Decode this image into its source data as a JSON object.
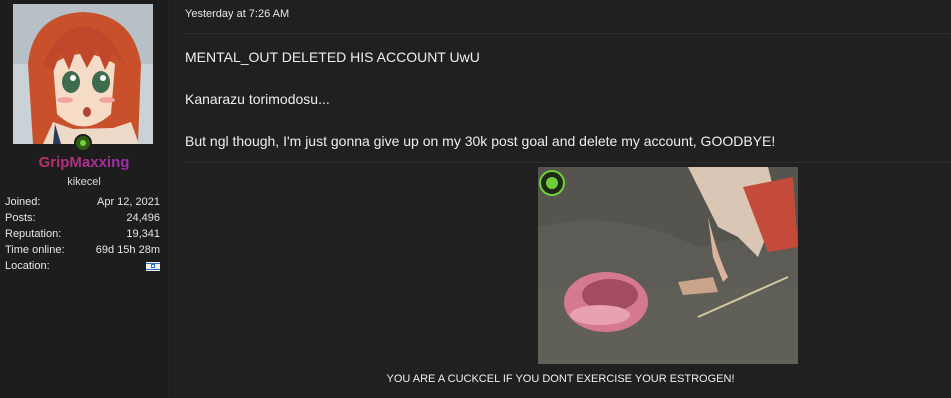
{
  "user": {
    "avatar_icon": "anime-girl-avatar",
    "online_status": "online",
    "online_color": "#7ad03a",
    "username": "GripMaxxing",
    "username_gradient": [
      "#d02d4a",
      "#8b2fcf"
    ],
    "usertitle": "kikecel",
    "stats": [
      {
        "label": "Joined:",
        "value": "Apr 12, 2021"
      },
      {
        "label": "Posts:",
        "value": "24,496"
      },
      {
        "label": "Reputation:",
        "value": "19,341"
      },
      {
        "label": "Time online:",
        "value": "69d 15h 28m"
      },
      {
        "label": "Location:",
        "value": "",
        "icon": "israel-flag-icon"
      }
    ]
  },
  "post": {
    "timestamp": "Yesterday at 7:26 AM",
    "lines": [
      "MENTAL_OUT DELETED HIS ACCOUNT UwU",
      "Kanarazu torimodosu...",
      "But ngl though, I'm just gonna give up on my 30k post goal and delete my account, GOODBYE!"
    ],
    "media_icon": "animated-gif-image",
    "caption": "YOU ARE A CUCKCEL IF YOU DONT EXERCISE YOUR ESTROGEN!"
  }
}
